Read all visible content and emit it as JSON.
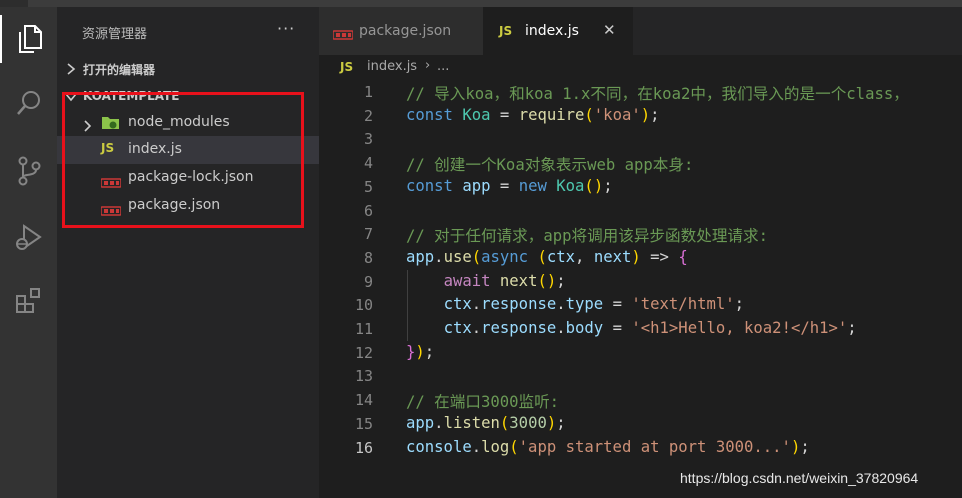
{
  "sidebar": {
    "title": "资源管理器",
    "more": "···",
    "open_editors": "打开的编辑器",
    "project": "KOATEMPLATE",
    "files": [
      {
        "name": "node_modules",
        "icon": "node-folder-icon"
      },
      {
        "name": "index.js",
        "icon": "js-file-icon",
        "badge": "JS"
      },
      {
        "name": "package-lock.json",
        "icon": "json-file-icon"
      },
      {
        "name": "package.json",
        "icon": "json-file-icon"
      }
    ]
  },
  "tabs": [
    {
      "label": "package.json",
      "icon": "json-file-icon"
    },
    {
      "label": "index.js",
      "icon": "js-file-icon",
      "badge": "JS",
      "close": "✕"
    }
  ],
  "breadcrumb": {
    "badge": "JS",
    "file": "index.js",
    "sep": "›",
    "more": "..."
  },
  "editor": {
    "line_numbers": [
      "1",
      "2",
      "3",
      "4",
      "5",
      "6",
      "7",
      "8",
      "9",
      "10",
      "11",
      "12",
      "13",
      "14",
      "15",
      "16"
    ],
    "current_line": "16",
    "lines": [
      "// 导入koa，和koa 1.x不同，在koa2中，我们导入的是一个class，",
      "const Koa = require('koa');",
      "",
      "// 创建一个Koa对象表示web app本身:",
      "const app = new Koa();",
      "",
      "// 对于任何请求，app将调用该异步函数处理请求:",
      "app.use(async (ctx, next) => {",
      "    await next();",
      "    ctx.response.type = 'text/html';",
      "    ctx.response.body = '<h1>Hello, koa2!</h1>';",
      "});",
      "",
      "// 在端口3000监听:",
      "app.listen(3000);",
      "console.log('app started at port 3000...');"
    ]
  },
  "watermark": "https://blog.csdn.net/weixin_37820964",
  "colors": {
    "comment": "#6a9955",
    "keyword": "#569cd6",
    "class": "#4ec9b0",
    "function": "#dcdcaa",
    "string": "#ce9178",
    "variable": "#9cdcfe",
    "highlight_box": "#e8111b"
  }
}
